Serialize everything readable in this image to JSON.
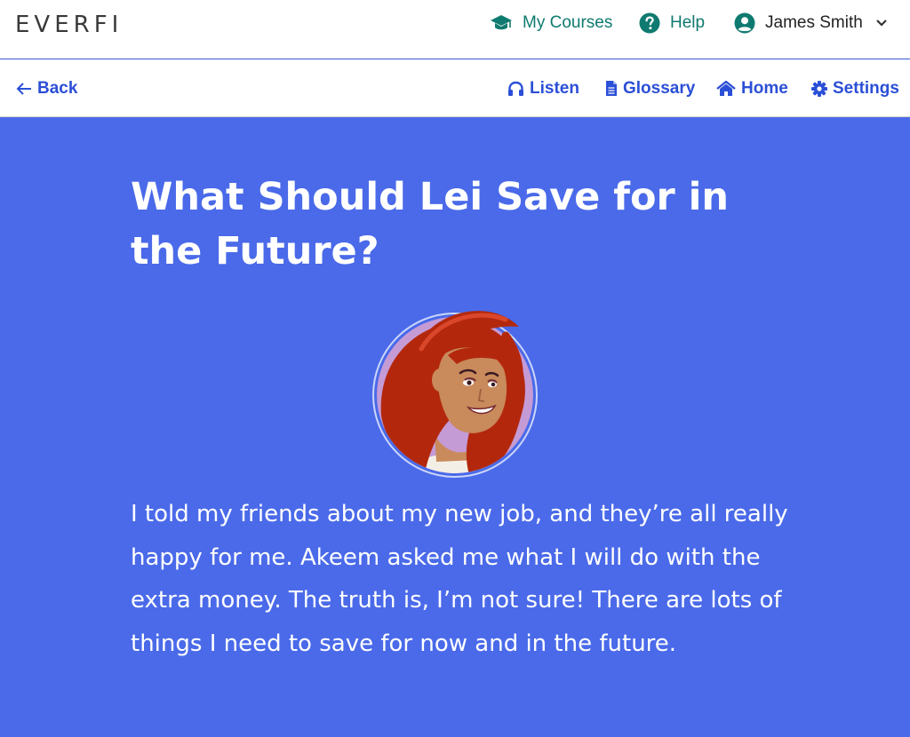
{
  "brand": {
    "logo_text": "EVERFI"
  },
  "topnav": {
    "my_courses": "My Courses",
    "help": "Help",
    "user_name": "James Smith"
  },
  "subnav": {
    "back": "Back",
    "listen": "Listen",
    "glossary": "Glossary",
    "home": "Home",
    "settings": "Settings"
  },
  "lesson": {
    "title": "What Should Lei Save for in the Future?",
    "body": "I told my friends about my new job, and they’re all really happy for me. Akeem asked me what I will do with the extra money. The truth is, I’m not sure! There are lots of things I need to save for now and in the future."
  },
  "colors": {
    "background": "#4a6ae9",
    "teal": "#0f7a70",
    "link_blue": "#2b4fd6",
    "avatar_hair": "#b3280d",
    "avatar_bg": "#c59bd6"
  },
  "icons": [
    "graduation-cap-icon",
    "help-circle-icon",
    "user-circle-icon",
    "chevron-down-icon",
    "arrow-left-icon",
    "headphones-icon",
    "document-icon",
    "home-icon",
    "gear-icon"
  ]
}
